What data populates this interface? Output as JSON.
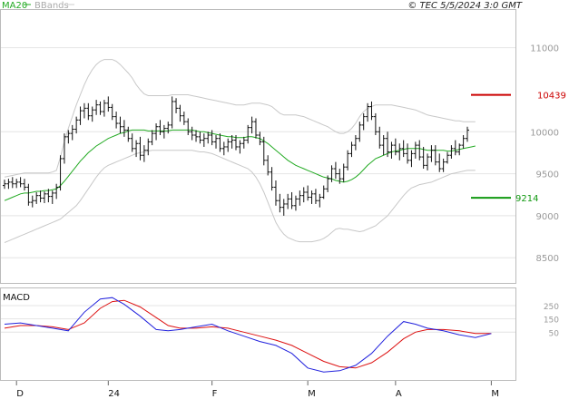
{
  "header": {
    "ma_label": "MA20",
    "bb_label": "BBands",
    "copyright": "© TEC 5/5/2024 3:0 GMT"
  },
  "colors": {
    "ma": "#22aa22",
    "bands": "#c8c8c8",
    "bars": "#111111",
    "resistance": "#cc0000",
    "support": "#119911",
    "macd": "#2222dd",
    "signal": "#dd1111",
    "grid": "#e4e4e4",
    "axis_text": "#999999"
  },
  "levels": {
    "resistance": {
      "value": 10439,
      "label": "10439"
    },
    "support": {
      "value": 9214,
      "label": "9214"
    }
  },
  "macd_panel": {
    "title": "MACD"
  },
  "chart_data": [
    {
      "type": "ohlc",
      "title": "",
      "y_ticks": [
        {
          "value": 8500,
          "label": "8500"
        },
        {
          "value": 9000,
          "label": "9000"
        },
        {
          "value": 9500,
          "label": "9500"
        },
        {
          "value": 10000,
          "label": "10000"
        },
        {
          "value": 11000,
          "label": "11000"
        }
      ],
      "ylim": [
        8200,
        11450
      ],
      "x_ticks": [
        {
          "label": "D",
          "bar": 3
        },
        {
          "label": "24",
          "bar": 26
        },
        {
          "label": "F",
          "bar": 52
        },
        {
          "label": "M",
          "bar": 76
        },
        {
          "label": "A",
          "bar": 98
        },
        {
          "label": "M",
          "bar": 122
        }
      ],
      "bars": [
        [
          9360,
          9430,
          9320,
          9380
        ],
        [
          9380,
          9440,
          9320,
          9400
        ],
        [
          9400,
          9460,
          9330,
          9380
        ],
        [
          9380,
          9440,
          9330,
          9400
        ],
        [
          9400,
          9460,
          9340,
          9380
        ],
        [
          9380,
          9440,
          9300,
          9340
        ],
        [
          9340,
          9380,
          9120,
          9160
        ],
        [
          9160,
          9240,
          9100,
          9180
        ],
        [
          9180,
          9280,
          9140,
          9240
        ],
        [
          9240,
          9300,
          9160,
          9210
        ],
        [
          9210,
          9290,
          9150,
          9260
        ],
        [
          9260,
          9320,
          9160,
          9230
        ],
        [
          9230,
          9300,
          9140,
          9270
        ],
        [
          9270,
          9380,
          9200,
          9340
        ],
        [
          9340,
          9720,
          9300,
          9680
        ],
        [
          9680,
          9980,
          9620,
          9940
        ],
        [
          9940,
          10020,
          9860,
          9980
        ],
        [
          9980,
          10080,
          9900,
          10030
        ],
        [
          10030,
          10180,
          9980,
          10140
        ],
        [
          10140,
          10300,
          10080,
          10250
        ],
        [
          10250,
          10340,
          10160,
          10280
        ],
        [
          10280,
          10340,
          10140,
          10190
        ],
        [
          10190,
          10300,
          10120,
          10260
        ],
        [
          10260,
          10380,
          10200,
          10320
        ],
        [
          10320,
          10360,
          10200,
          10240
        ],
        [
          10240,
          10380,
          10180,
          10340
        ],
        [
          10340,
          10420,
          10240,
          10290
        ],
        [
          10290,
          10330,
          10140,
          10180
        ],
        [
          10180,
          10240,
          10040,
          10100
        ],
        [
          10100,
          10180,
          9980,
          10060
        ],
        [
          10060,
          10140,
          9940,
          10020
        ],
        [
          10020,
          10060,
          9880,
          9920
        ],
        [
          9920,
          9980,
          9760,
          9800
        ],
        [
          9800,
          9900,
          9700,
          9860
        ],
        [
          9860,
          9940,
          9660,
          9720
        ],
        [
          9720,
          9840,
          9640,
          9780
        ],
        [
          9780,
          9920,
          9720,
          9880
        ],
        [
          9880,
          10020,
          9840,
          9980
        ],
        [
          9980,
          10100,
          9900,
          10060
        ],
        [
          10060,
          10140,
          9960,
          10000
        ],
        [
          10000,
          10080,
          9920,
          10040
        ],
        [
          10040,
          10120,
          9980,
          10080
        ],
        [
          10080,
          10420,
          10040,
          10360
        ],
        [
          10360,
          10400,
          10220,
          10280
        ],
        [
          10280,
          10320,
          10120,
          10190
        ],
        [
          10190,
          10240,
          10080,
          10120
        ],
        [
          10120,
          10160,
          9960,
          10000
        ],
        [
          10000,
          10060,
          9900,
          9960
        ],
        [
          9960,
          10020,
          9880,
          9940
        ],
        [
          9940,
          10000,
          9860,
          9900
        ],
        [
          9900,
          9980,
          9820,
          9920
        ],
        [
          9920,
          10000,
          9860,
          9960
        ],
        [
          9960,
          10020,
          9840,
          9880
        ],
        [
          9880,
          9960,
          9800,
          9920
        ],
        [
          9920,
          9980,
          9760,
          9800
        ],
        [
          9800,
          9880,
          9720,
          9820
        ],
        [
          9820,
          9920,
          9760,
          9880
        ],
        [
          9880,
          9960,
          9800,
          9900
        ],
        [
          9900,
          9960,
          9780,
          9820
        ],
        [
          9820,
          9900,
          9740,
          9860
        ],
        [
          9860,
          9940,
          9800,
          9900
        ],
        [
          9900,
          10080,
          9860,
          10050
        ],
        [
          10050,
          10180,
          9980,
          10120
        ],
        [
          10120,
          10160,
          9920,
          9960
        ],
        [
          9960,
          10000,
          9840,
          9880
        ],
        [
          9880,
          9940,
          9600,
          9660
        ],
        [
          9660,
          9720,
          9480,
          9520
        ],
        [
          9520,
          9580,
          9300,
          9340
        ],
        [
          9340,
          9420,
          9120,
          9180
        ],
        [
          9180,
          9260,
          9040,
          9100
        ],
        [
          9100,
          9200,
          9000,
          9140
        ],
        [
          9140,
          9260,
          9080,
          9200
        ],
        [
          9200,
          9280,
          9080,
          9120
        ],
        [
          9120,
          9240,
          9060,
          9200
        ],
        [
          9200,
          9300,
          9120,
          9240
        ],
        [
          9240,
          9340,
          9160,
          9280
        ],
        [
          9280,
          9360,
          9180,
          9220
        ],
        [
          9220,
          9300,
          9140,
          9260
        ],
        [
          9260,
          9320,
          9140,
          9180
        ],
        [
          9180,
          9260,
          9100,
          9220
        ],
        [
          9220,
          9360,
          9200,
          9320
        ],
        [
          9320,
          9480,
          9280,
          9440
        ],
        [
          9440,
          9600,
          9400,
          9560
        ],
        [
          9560,
          9640,
          9440,
          9500
        ],
        [
          9500,
          9560,
          9380,
          9440
        ],
        [
          9440,
          9620,
          9400,
          9580
        ],
        [
          9580,
          9780,
          9540,
          9740
        ],
        [
          9740,
          9880,
          9700,
          9840
        ],
        [
          9840,
          9960,
          9780,
          9920
        ],
        [
          9920,
          10120,
          9880,
          10080
        ],
        [
          10080,
          10220,
          10020,
          10180
        ],
        [
          10180,
          10340,
          10120,
          10300
        ],
        [
          10300,
          10360,
          10140,
          10180
        ],
        [
          10180,
          10220,
          9960,
          10000
        ],
        [
          10000,
          10060,
          9800,
          9840
        ],
        [
          9840,
          9960,
          9720,
          9920
        ],
        [
          9920,
          10000,
          9700,
          9760
        ],
        [
          9760,
          9880,
          9680,
          9840
        ],
        [
          9840,
          9920,
          9720,
          9760
        ],
        [
          9760,
          9860,
          9660,
          9800
        ],
        [
          9800,
          9900,
          9700,
          9740
        ],
        [
          9740,
          9860,
          9620,
          9660
        ],
        [
          9660,
          9780,
          9580,
          9740
        ],
        [
          9740,
          9880,
          9680,
          9840
        ],
        [
          9840,
          9900,
          9660,
          9700
        ],
        [
          9700,
          9820,
          9560,
          9600
        ],
        [
          9600,
          9740,
          9540,
          9700
        ],
        [
          9700,
          9840,
          9640,
          9780
        ],
        [
          9780,
          9840,
          9600,
          9640
        ],
        [
          9640,
          9740,
          9520,
          9560
        ],
        [
          9560,
          9680,
          9520,
          9640
        ],
        [
          9640,
          9760,
          9620,
          9720
        ],
        [
          9720,
          9840,
          9680,
          9800
        ],
        [
          9800,
          9900,
          9720,
          9760
        ],
        [
          9760,
          9860,
          9720,
          9840
        ],
        [
          9840,
          9960,
          9800,
          9920
        ],
        [
          9920,
          10060,
          9880,
          10020
        ]
      ],
      "ma20": [
        9180,
        9200,
        9220,
        9240,
        9260,
        9270,
        9270,
        9280,
        9290,
        9290,
        9300,
        9300,
        9310,
        9320,
        9360,
        9410,
        9470,
        9530,
        9590,
        9650,
        9700,
        9750,
        9790,
        9830,
        9860,
        9890,
        9920,
        9940,
        9960,
        9980,
        9990,
        10010,
        10020,
        10020,
        10020,
        10020,
        10010,
        10010,
        10010,
        10010,
        10010,
        10010,
        10020,
        10020,
        10020,
        10020,
        10020,
        10020,
        10010,
        10000,
        10000,
        9990,
        9980,
        9970,
        9960,
        9950,
        9940,
        9940,
        9930,
        9930,
        9930,
        9940,
        9940,
        9930,
        9920,
        9890,
        9860,
        9820,
        9780,
        9740,
        9700,
        9660,
        9630,
        9600,
        9580,
        9560,
        9540,
        9520,
        9500,
        9480,
        9460,
        9450,
        9440,
        9420,
        9410,
        9400,
        9410,
        9430,
        9460,
        9500,
        9550,
        9600,
        9640,
        9680,
        9700,
        9720,
        9740,
        9760,
        9770,
        9780,
        9790,
        9800,
        9800,
        9800,
        9800,
        9790,
        9780,
        9780,
        9780,
        9780,
        9780,
        9770,
        9770,
        9780,
        9790,
        9800,
        9810,
        9820,
        9830
      ],
      "bb_upper": [
        9460,
        9470,
        9480,
        9490,
        9500,
        9510,
        9510,
        9510,
        9510,
        9510,
        9510,
        9510,
        9520,
        9540,
        9700,
        9880,
        10040,
        10180,
        10320,
        10440,
        10560,
        10660,
        10740,
        10800,
        10840,
        10860,
        10860,
        10860,
        10840,
        10800,
        10750,
        10700,
        10640,
        10560,
        10500,
        10450,
        10430,
        10430,
        10430,
        10430,
        10430,
        10430,
        10440,
        10440,
        10440,
        10440,
        10440,
        10430,
        10420,
        10410,
        10400,
        10390,
        10380,
        10370,
        10360,
        10350,
        10340,
        10330,
        10320,
        10320,
        10320,
        10330,
        10340,
        10340,
        10340,
        10330,
        10320,
        10300,
        10260,
        10220,
        10200,
        10200,
        10200,
        10200,
        10190,
        10180,
        10160,
        10140,
        10120,
        10100,
        10080,
        10060,
        10030,
        10000,
        9980,
        9980,
        10000,
        10040,
        10100,
        10180,
        10240,
        10280,
        10300,
        10320,
        10320,
        10320,
        10320,
        10320,
        10310,
        10300,
        10290,
        10280,
        10270,
        10260,
        10240,
        10220,
        10200,
        10190,
        10180,
        10170,
        10160,
        10150,
        10140,
        10130,
        10130,
        10120,
        10120,
        10120,
        10120
      ],
      "bb_lower": [
        8680,
        8700,
        8720,
        8740,
        8760,
        8780,
        8800,
        8820,
        8840,
        8860,
        8880,
        8900,
        8920,
        8940,
        8960,
        9000,
        9040,
        9080,
        9120,
        9180,
        9250,
        9320,
        9390,
        9460,
        9520,
        9570,
        9600,
        9620,
        9640,
        9660,
        9680,
        9700,
        9720,
        9740,
        9750,
        9760,
        9770,
        9780,
        9780,
        9780,
        9780,
        9780,
        9780,
        9780,
        9780,
        9780,
        9780,
        9780,
        9770,
        9760,
        9760,
        9750,
        9740,
        9720,
        9700,
        9680,
        9660,
        9640,
        9620,
        9600,
        9580,
        9560,
        9520,
        9460,
        9380,
        9280,
        9160,
        9040,
        8920,
        8840,
        8780,
        8740,
        8720,
        8700,
        8690,
        8690,
        8690,
        8690,
        8700,
        8710,
        8730,
        8760,
        8800,
        8840,
        8850,
        8840,
        8840,
        8830,
        8820,
        8810,
        8820,
        8840,
        8860,
        8880,
        8920,
        8960,
        9000,
        9060,
        9120,
        9180,
        9240,
        9290,
        9330,
        9350,
        9370,
        9380,
        9390,
        9400,
        9420,
        9440,
        9460,
        9480,
        9500,
        9510,
        9520,
        9530,
        9540,
        9540,
        9540
      ]
    },
    {
      "type": "line",
      "title": "MACD",
      "y_ticks": [
        {
          "value": 50,
          "label": "50"
        },
        {
          "value": 150,
          "label": "150"
        },
        {
          "value": 250,
          "label": "250"
        }
      ],
      "ylim": [
        -310,
        380
      ],
      "macd_x": [
        0,
        4,
        8,
        12,
        16,
        20,
        24,
        27,
        30,
        34,
        38,
        41,
        44,
        48,
        52,
        56,
        60,
        64,
        68,
        72,
        76,
        80,
        84,
        88,
        92,
        96,
        100,
        103,
        106,
        110,
        114,
        118,
        122
      ],
      "macd": [
        110,
        120,
        100,
        80,
        60,
        200,
        300,
        310,
        260,
        170,
        70,
        60,
        70,
        90,
        110,
        60,
        20,
        -20,
        -50,
        -110,
        -220,
        -250,
        -240,
        -200,
        -110,
        20,
        130,
        110,
        80,
        60,
        30,
        10,
        40
      ],
      "signal_x": [
        0,
        4,
        8,
        12,
        16,
        20,
        24,
        27,
        30,
        34,
        38,
        41,
        44,
        48,
        52,
        56,
        60,
        64,
        68,
        72,
        76,
        80,
        84,
        88,
        92,
        96,
        100,
        103,
        106,
        110,
        114,
        118,
        122
      ],
      "signal": [
        80,
        100,
        100,
        90,
        70,
        120,
        230,
        280,
        290,
        240,
        160,
        100,
        80,
        80,
        90,
        80,
        50,
        20,
        -10,
        -50,
        -110,
        -170,
        -210,
        -220,
        -180,
        -100,
        0,
        50,
        70,
        70,
        60,
        40,
        40
      ]
    }
  ]
}
